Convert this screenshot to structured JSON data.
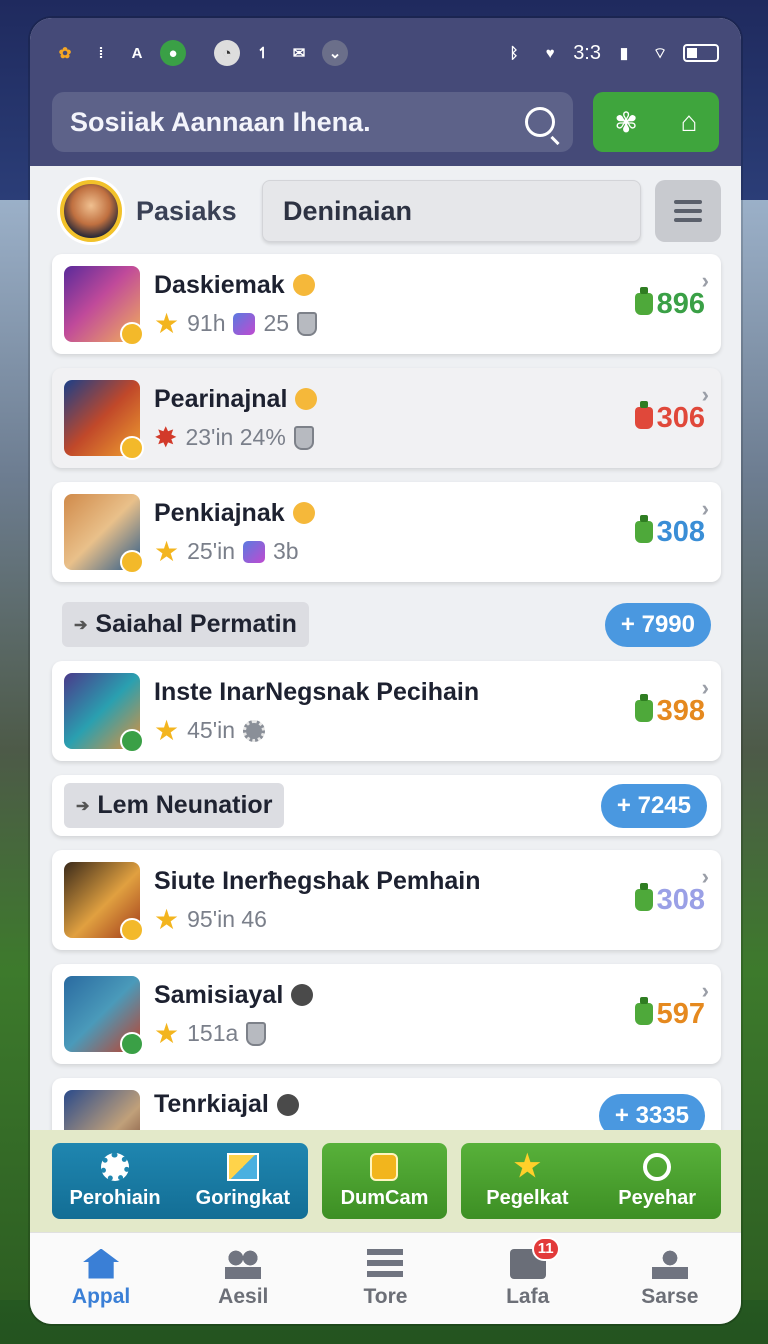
{
  "search": {
    "placeholder": "Sosiiak Aannaan Ihena."
  },
  "status": {
    "time": "3:3"
  },
  "profile": {
    "name": "Pasiaks",
    "dropdown": "Deninaian"
  },
  "items": [
    {
      "title": "Daskiemak",
      "meta1": "91h",
      "meta2": "25",
      "price": "896",
      "price_color": "#3aa046"
    },
    {
      "title": "Pearinajnal",
      "meta1": "23'in 24%",
      "price": "306",
      "price_color": "#e0483a"
    },
    {
      "title": "Penkiajnak",
      "meta1": "25'in",
      "meta2": "3b",
      "price": "308",
      "price_color": "#3a8ed6"
    },
    {
      "title": "Inste InarNegsnak Pecihain",
      "meta1": "45'in",
      "price": "398",
      "price_color": "#e5891f"
    },
    {
      "title": "Siute Inerħegshak Pemhain",
      "meta1": "95'in 46",
      "price": "308",
      "price_color": "#9aa0e6"
    },
    {
      "title": "Samisiayal",
      "meta1": "151a",
      "price": "597",
      "price_color": "#e5891f"
    },
    {
      "title": "Tenrkiajal"
    }
  ],
  "sections": [
    {
      "label": "Saiahal Permatin",
      "value": "+ 7990"
    },
    {
      "label": "Lem Neunatior",
      "value": "+ 7245"
    },
    {
      "value": "+ 3335"
    }
  ],
  "actions": {
    "a1": "Perohiain",
    "a2": "Goringkat",
    "a3": "DumCam",
    "a4": "Pegelkat",
    "a5": "Peyehar"
  },
  "tabs": [
    {
      "label": "Appal"
    },
    {
      "label": "Aesil"
    },
    {
      "label": "Tore"
    },
    {
      "label": "Lafa",
      "badge": "11"
    },
    {
      "label": "Sarse"
    }
  ]
}
